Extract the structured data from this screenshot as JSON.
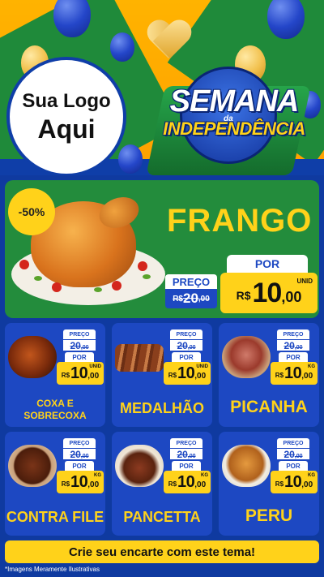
{
  "header": {
    "logo_line1": "Sua Logo",
    "logo_line2": "Aqui",
    "theme_title": "SEMANA",
    "theme_connector": "da",
    "theme_subtitle": "INDEPENDÊNCIA"
  },
  "hero": {
    "discount_badge": "-50%",
    "product_name": "FRANGO",
    "label_before": "PREÇO",
    "old_price": {
      "currency": "R$",
      "integer": "20",
      "decimal": ",00"
    },
    "label_now": "POR",
    "new_price": {
      "currency": "R$",
      "integer": "10",
      "decimal": ",00",
      "unit": "UNID"
    }
  },
  "products": [
    {
      "name": "COXA E SOBRECOXA",
      "label_before": "PREÇO",
      "old_price": "20",
      "old_decimal": ",00",
      "label_now": "POR",
      "currency": "R$",
      "price_integer": "10",
      "price_decimal": ",00",
      "unit": "UNID"
    },
    {
      "name": "MEDALHÃO",
      "label_before": "PREÇO",
      "old_price": "20",
      "old_decimal": ",00",
      "label_now": "POR",
      "currency": "R$",
      "price_integer": "10",
      "price_decimal": ",00",
      "unit": "UNID"
    },
    {
      "name": "PICANHA",
      "label_before": "PREÇO",
      "old_price": "20",
      "old_decimal": ",00",
      "label_now": "POR",
      "currency": "R$",
      "price_integer": "10",
      "price_decimal": ",00",
      "unit": "KG"
    },
    {
      "name": "CONTRA FILE",
      "label_before": "PREÇO",
      "old_price": "20",
      "old_decimal": ",00",
      "label_now": "POR",
      "currency": "R$",
      "price_integer": "10",
      "price_decimal": ",00",
      "unit": "KG"
    },
    {
      "name": "PANCETTA",
      "label_before": "PREÇO",
      "old_price": "20",
      "old_decimal": ",00",
      "label_now": "POR",
      "currency": "R$",
      "price_integer": "10",
      "price_decimal": ",00",
      "unit": "KG"
    },
    {
      "name": "PERU",
      "label_before": "PREÇO",
      "old_price": "20",
      "old_decimal": ",00",
      "label_now": "POR",
      "currency": "R$",
      "price_integer": "10",
      "price_decimal": ",00",
      "unit": "KG"
    }
  ],
  "cta": "Crie seu encarte com este tema!",
  "footnote": "*Imagens Meramente Ilustrativas",
  "colors": {
    "accent_yellow": "#ffd21a",
    "brand_blue": "#1d48c2",
    "brand_green": "#238c3c",
    "header_orange": "#ffa000"
  }
}
